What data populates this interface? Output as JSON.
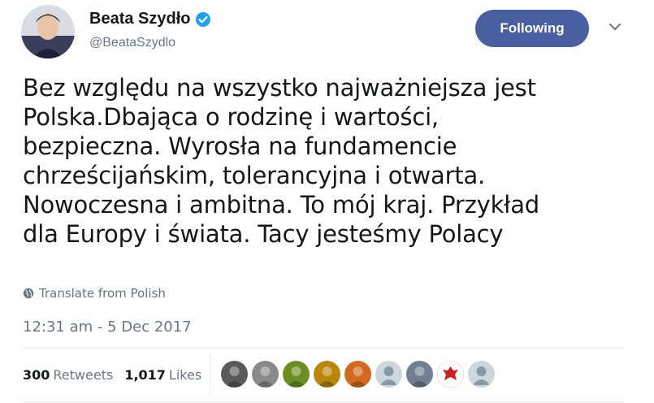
{
  "author": {
    "name": "Beata Szydło",
    "handle": "@BeataSzydlo",
    "verified_icon": "verified-badge-icon"
  },
  "follow_button": {
    "label": "Following",
    "color": "#4a5fa1"
  },
  "tweet": {
    "lines": [
      "Bez względu na wszystko najważniejsza jest",
      "Polska.Dbająca o rodzinę i wartości,",
      "bezpieczna. Wyrosła na fundamencie",
      "chrześcijańskim, tolerancyjna i otwarta.",
      "Nowoczesna i ambitna. To mój kraj. Przykład",
      "dla Europy i świata. Tacy jesteśmy Polacy"
    ]
  },
  "translate": {
    "label": "Translate from Polish",
    "icon": "globe-icon"
  },
  "timestamp": "12:31 am - 5 Dec 2017",
  "stats": {
    "retweets_count": "300",
    "retweets_label": "Retweets",
    "likes_count": "1,017",
    "likes_label": "Likes"
  },
  "likers": [
    {
      "icon": "liker-avatar-1-icon",
      "color": "#5a5a5a"
    },
    {
      "icon": "liker-avatar-2-icon",
      "color": "#8a8a8a"
    },
    {
      "icon": "liker-avatar-3-icon",
      "color": "#6b8e23"
    },
    {
      "icon": "liker-avatar-4-icon",
      "color": "#b8860b"
    },
    {
      "icon": "liker-avatar-5-icon",
      "color": "#d2691e"
    },
    {
      "icon": "default-avatar-icon",
      "color": "#ccd6dd"
    },
    {
      "icon": "liker-avatar-7-icon",
      "color": "#708090"
    },
    {
      "icon": "eagle-emblem-icon",
      "color": "#cc2222"
    },
    {
      "icon": "default-avatar-icon",
      "color": "#ccd6dd"
    }
  ]
}
